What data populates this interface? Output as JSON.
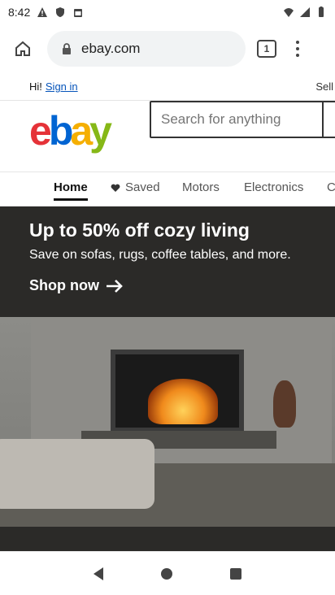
{
  "status_bar": {
    "time": "8:42"
  },
  "browser": {
    "url": "ebay.com",
    "tab_count": "1"
  },
  "page": {
    "greeting": "Hi!",
    "sign_in": "Sign in",
    "sell": "Sell",
    "search_placeholder": "Search for anything",
    "nav_tabs": [
      "Home",
      "Saved",
      "Motors",
      "Electronics",
      "C"
    ],
    "banner": {
      "title": "Up to 50% off cozy living",
      "subtitle": "Save on sofas, rugs, coffee tables, and more.",
      "cta": "Shop now"
    }
  }
}
